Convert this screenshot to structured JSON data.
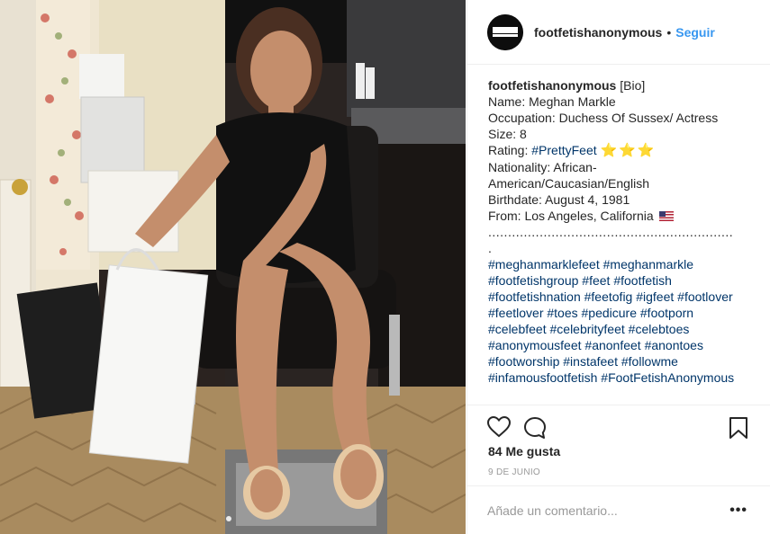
{
  "post": {
    "username": "footfetishanonymous",
    "separator": "•",
    "follow_label": "Seguir",
    "avatar_text": "FOOT FETISH"
  },
  "caption": {
    "user": "footfetishanonymous",
    "tag": "[Bio]",
    "lines": {
      "name": "Name: Meghan Markle",
      "occupation": "Occupation: Duchess Of Sussex/ Actress",
      "size": "Size: 8",
      "rating_prefix": "Rating: ",
      "rating_tag": "#PrettyFeet",
      "rating_stars": "⭐⭐⭐",
      "nationality": "Nationality: African-American/Caucasian/English",
      "birthdate": "Birthdate: August 4, 1981",
      "from": "From: Los Angeles, California"
    },
    "dotted_separator": "..............................................................",
    "dot_line": ".",
    "hashtags": "#meghanmarklefeet #meghanmarkle #footfetishgroup #feet #footfetish #footfetishnation #feetofig #igfeet #footlover #feetlover #toes #pedicure #footporn #celebfeet #celebrityfeet #celebtoes #anonymousfeet #anonfeet #anontoes #footworship #instafeet #followme #infamousfootfetish #FootFetishAnonymous"
  },
  "stats": {
    "likes": "84 Me gusta",
    "date": "9 DE JUNIO"
  },
  "comment": {
    "placeholder": "Añade un comentario...",
    "more": "•••"
  },
  "icons": {
    "like": "heart-icon",
    "comment": "comment-icon",
    "save": "bookmark-icon"
  },
  "colors": {
    "link": "#3897f0",
    "hashtag": "#003569",
    "text": "#262626",
    "muted": "#999999"
  }
}
